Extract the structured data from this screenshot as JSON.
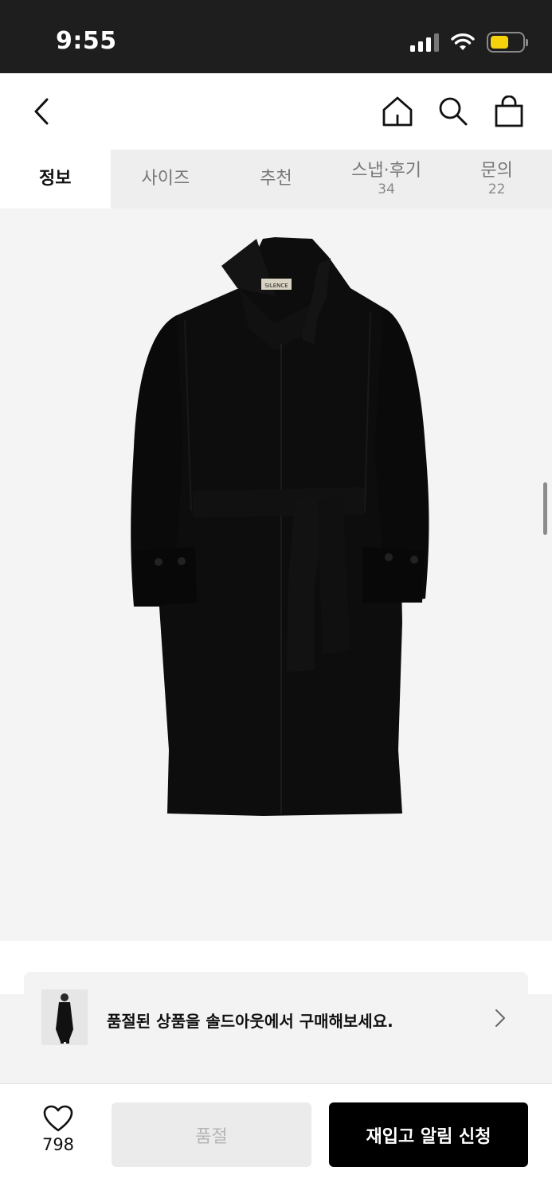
{
  "status_bar": {
    "time": "9:55",
    "icons": [
      "signal-icon",
      "wifi-icon",
      "battery-icon"
    ],
    "battery_color": "#f5d20b"
  },
  "header": {
    "icons": [
      "back-arrow-icon",
      "home-icon",
      "search-icon",
      "shopping-bag-icon"
    ]
  },
  "tabs": [
    {
      "label": "정보",
      "count": "",
      "active": true
    },
    {
      "label": "사이즈",
      "count": ""
    },
    {
      "label": "추천",
      "count": ""
    },
    {
      "label": "스냅·후기",
      "count": "34"
    },
    {
      "label": "문의",
      "count": "22"
    }
  ],
  "product": {
    "image": "black-belted-long-coat",
    "label_text": "SILENCE",
    "background_color": "#f4f4f4"
  },
  "promo": {
    "text": "품절된 상품을 솔드아웃에서 구매해보세요.",
    "icon": "chevron-right-icon"
  },
  "bottom_bar": {
    "like_icon": "heart-icon",
    "like_count": "798",
    "soldout_label": "품절",
    "restock_label": "재입고 알림 신청"
  }
}
